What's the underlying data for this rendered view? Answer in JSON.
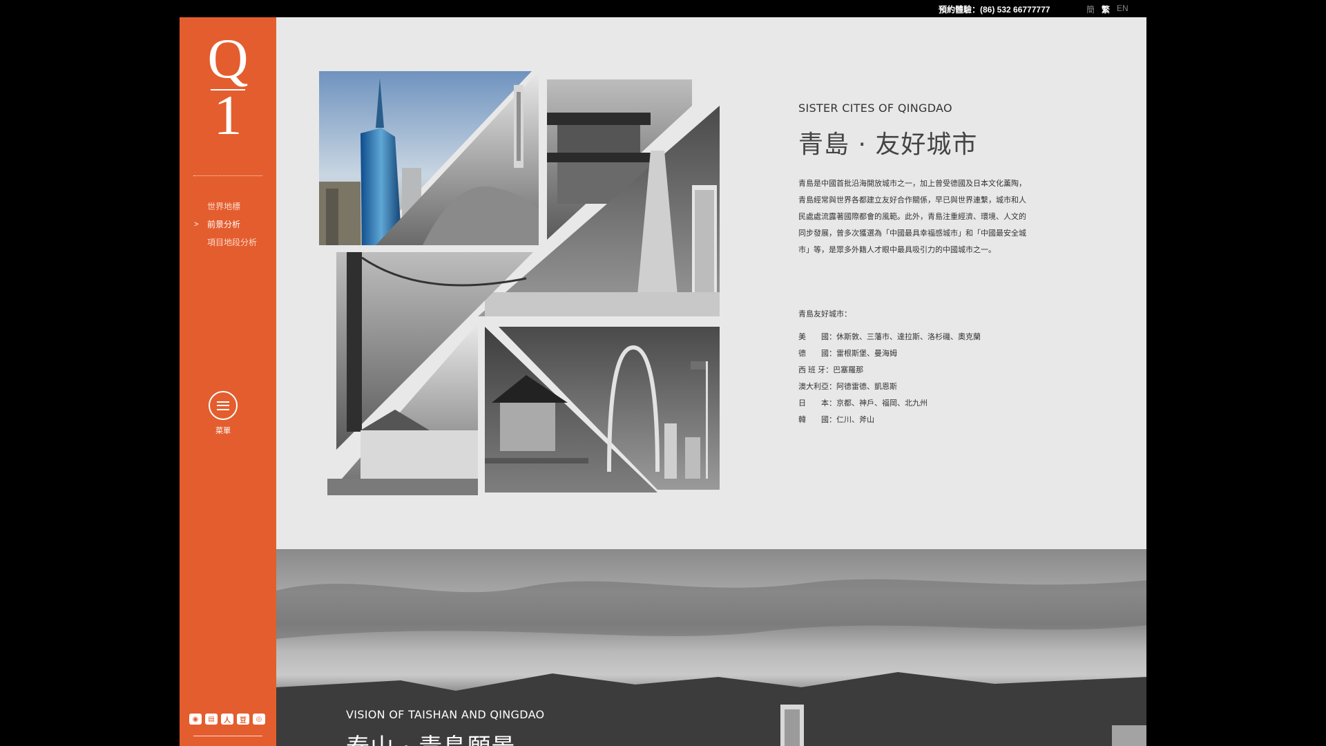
{
  "topbar": {
    "contact": "預約體驗：(86) 532 66777777",
    "languages": [
      "簡",
      "繁",
      "EN"
    ],
    "active_language": "繁"
  },
  "sidebar": {
    "logo_top": "Q",
    "logo_bottom": "1",
    "nav": [
      {
        "label": "世界地標"
      },
      {
        "label": "前景分析"
      },
      {
        "label": "項目地段分析"
      }
    ],
    "active_nav": "前景分析",
    "menu_label": "菜單",
    "social_icons": [
      "weibo-icon",
      "news-icon",
      "renren-icon",
      "douban-icon",
      "wechat-icon"
    ]
  },
  "sister_cities": {
    "subtitle": "SISTER CITES OF QINGDAO",
    "title": "青島 · 友好城市",
    "body": "青島是中國首批沿海開放城市之一，加上曾受德國及日本文化薰陶，青島經常與世界各都建立友好合作關係，早已與世界連繫，城市和人民處處流露著國際都會的風範。此外，青島注重經濟、環境、人文的同步發展，曾多次獲選為「中國最具幸福感城市」和「中國最安全城市」等，是眾多外籍人才眼中最具吸引力的中國城市之一。",
    "list_heading": "青島友好城市：",
    "cities": [
      {
        "country": "美　　國",
        "list": "休斯敦、三藩市、達拉斯、洛杉磯、奧克蘭"
      },
      {
        "country": "德　　國",
        "list": "雷根斯堡、曼海姆"
      },
      {
        "country": "西 班 牙",
        "list": "巴塞羅那"
      },
      {
        "country": "澳大利亞",
        "list": "阿德雷德、凱恩斯"
      },
      {
        "country": "日　　本",
        "list": "京都、神戶、福岡、北九州"
      },
      {
        "country": "韓　　國",
        "list": "仁川、斧山"
      }
    ]
  },
  "vision": {
    "subtitle": "VISION OF TAISHAN AND QINGDAO",
    "title": "泰山 · 青島願景"
  },
  "colors": {
    "sidebar": "#e45d2e",
    "main_bg": "#e8e8e8",
    "page_bg": "#000000"
  }
}
